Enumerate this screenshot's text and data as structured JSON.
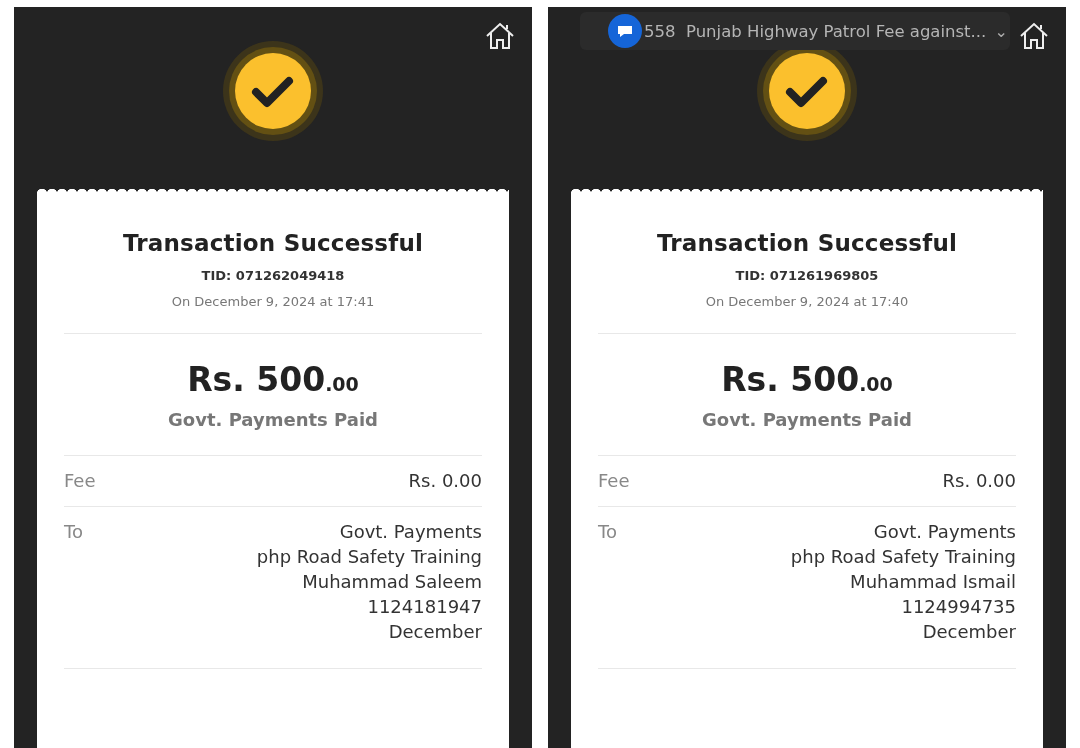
{
  "screens": [
    {
      "title": "Transaction Successful",
      "tid": "TID: 071262049418",
      "datetime": "On December 9, 2024 at 17:41",
      "amount": "Rs. 500",
      "amount_decimals": ".00",
      "status": "Govt. Payments Paid",
      "details": [
        {
          "label": "Fee",
          "lines": [
            "Rs. 0.00"
          ]
        },
        {
          "label": "To",
          "lines": [
            "Govt. Payments",
            "php Road Safety Training",
            "Muhammad Saleem",
            "1124181947",
            "December"
          ]
        }
      ]
    },
    {
      "notification": {
        "text": "558  Punjab Highway Patrol Fee against...",
        "chevron": "⌄"
      },
      "title": "Transaction Successful",
      "tid": "TID: 071261969805",
      "datetime": "On December 9, 2024 at 17:40",
      "amount": "Rs. 500",
      "amount_decimals": ".00",
      "status": "Govt. Payments Paid",
      "details": [
        {
          "label": "Fee",
          "lines": [
            "Rs. 0.00"
          ]
        },
        {
          "label": "To",
          "lines": [
            "Govt. Payments",
            "php Road Safety Training",
            "Muhammad Ismail",
            "1124994735",
            "December"
          ]
        }
      ]
    }
  ]
}
